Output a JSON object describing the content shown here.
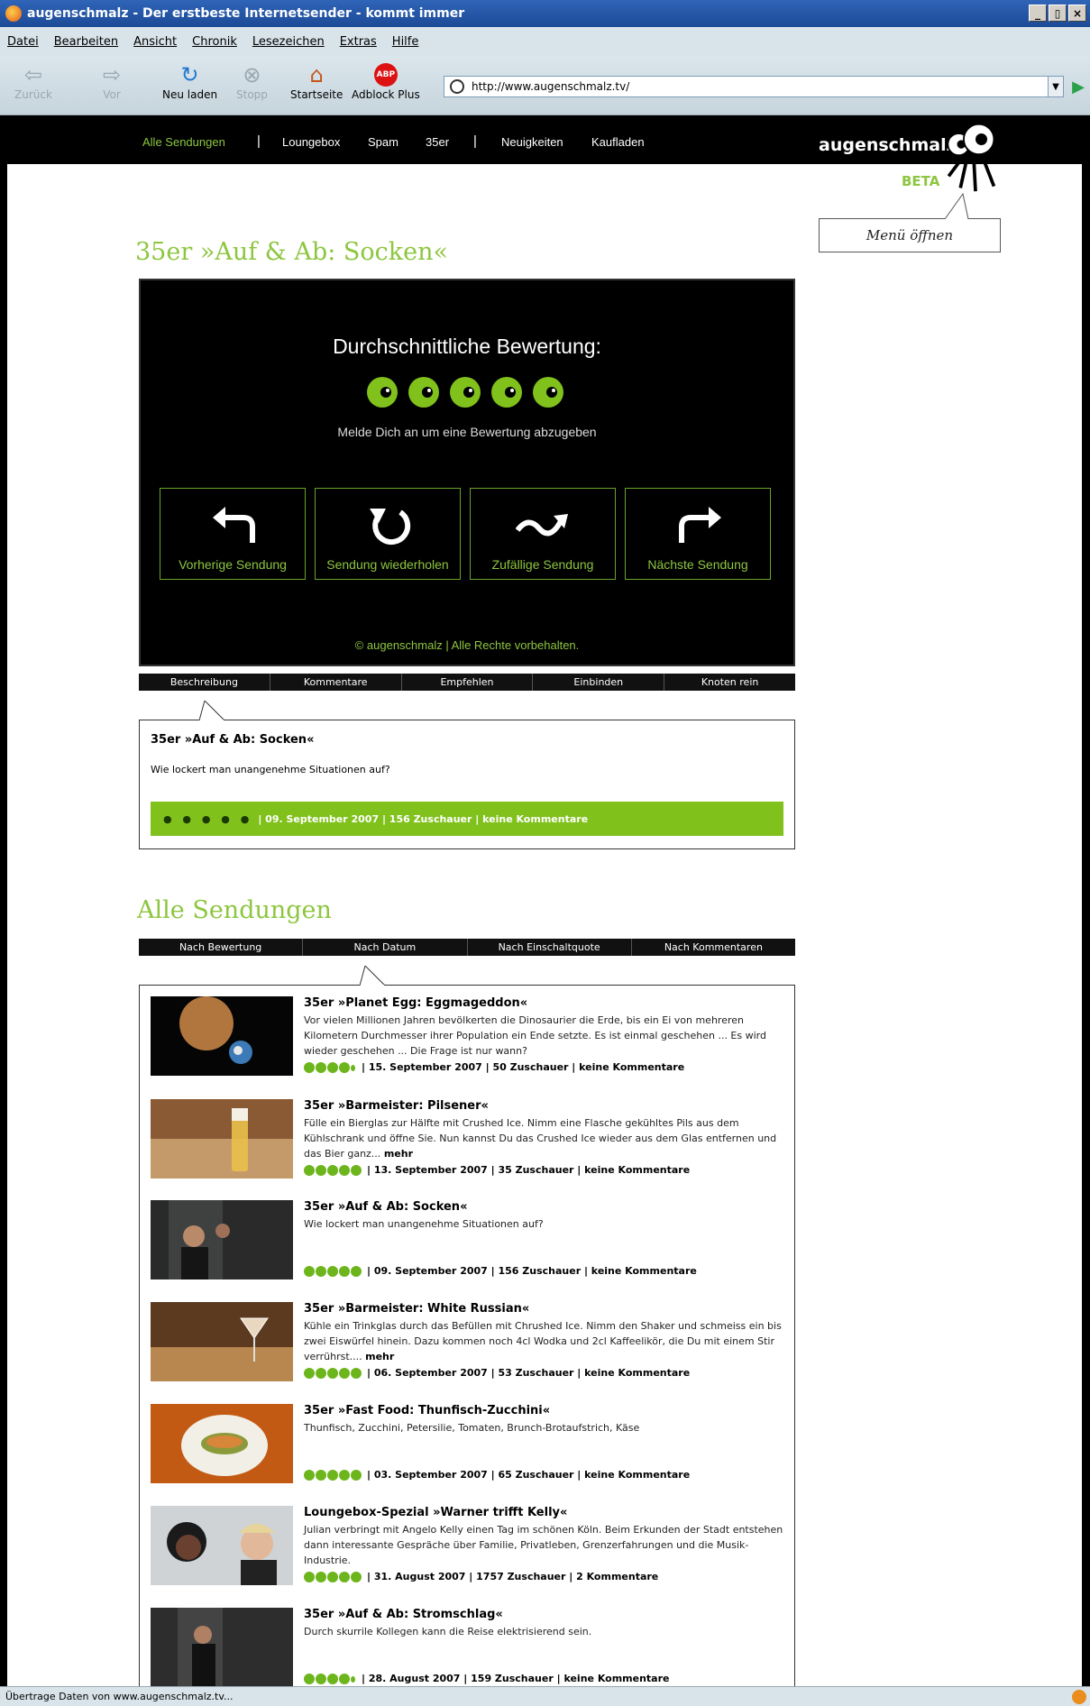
{
  "window": {
    "title": "augenschmalz - Der erstbeste Internetsender - kommt immer",
    "buttons": [
      "_",
      "▯",
      "×"
    ]
  },
  "menubar": [
    "Datei",
    "Bearbeiten",
    "Ansicht",
    "Chronik",
    "Lesezeichen",
    "Extras",
    "Hilfe"
  ],
  "toolbar": {
    "back": "Zurück",
    "forward": "Vor",
    "reload": "Neu laden",
    "stop": "Stopp",
    "home": "Startseite",
    "adblock": "Adblock Plus",
    "adblock_badge": "ABP",
    "url": "http://www.augenschmalz.tv/"
  },
  "sitenav": {
    "items": [
      "Alle Sendungen",
      "Loungebox",
      "Spam",
      "35er",
      "Neuigkeiten",
      "Kaufladen"
    ],
    "separator": "|"
  },
  "brand": {
    "logo": "augenschmalz",
    "beta": "BETA",
    "menu_button": "Menü öffnen"
  },
  "current": {
    "heading": "35er »Auf & Ab: Socken«",
    "avg_label": "Durchschnittliche Bewertung:",
    "login_hint": "Melde Dich an um eine Bewertung abzugeben",
    "nav": [
      "Vorherige Sendung",
      "Sendung wiederholen",
      "Zufällige Sendung",
      "Nächste Sendung"
    ],
    "copyright": "© augenschmalz | Alle Rechte vorbehalten.",
    "tabs": [
      "Beschreibung",
      "Kommentare",
      "Empfehlen",
      "Einbinden",
      "Knoten rein"
    ],
    "desc_title": "35er »Auf & Ab: Socken«",
    "desc_text": "Wie lockert man unangenehme Situationen auf?",
    "rating_dots": "● ● ● ● ●",
    "meta": "| 09. September 2007 | 156 Zuschauer | keine Kommentare"
  },
  "all": {
    "heading": "Alle Sendungen",
    "sort_tabs": [
      "Nach Bewertung",
      "Nach Datum",
      "Nach Einschaltquote",
      "Nach Kommentaren"
    ],
    "episodes": [
      {
        "title": "35er »Planet Egg: Eggmageddon«",
        "desc": "Vor vielen Millionen Jahren bevölkerten die Dinosaurier die Erde, bis ein Ei von mehreren Kilometern Durchmesser ihrer Population ein Ende setzte. Es ist einmal geschehen ... Es wird wieder geschehen ... Die Frage ist nur wann?",
        "more": "",
        "rating": 4.5,
        "meta": "| 15. September 2007 | 50 Zuschauer | keine Kommentare"
      },
      {
        "title": "35er »Barmeister: Pilsener«",
        "desc": "Fülle ein Bierglas zur Hälfte mit Crushed Ice. Nimm eine Flasche gekühltes Pils aus dem Kühlschrank und öffne Sie. Nun kannst Du das Crushed Ice wieder aus dem Glas entfernen und das Bier ganz...",
        "more": "mehr",
        "rating": 5,
        "meta": "| 13. September 2007 | 35 Zuschauer | keine Kommentare"
      },
      {
        "title": "35er »Auf & Ab: Socken«",
        "desc": "Wie lockert man unangenehme Situationen auf?",
        "more": "",
        "rating": 5,
        "meta": "| 09. September 2007 | 156 Zuschauer | keine Kommentare"
      },
      {
        "title": "35er »Barmeister: White Russian«",
        "desc": "Kühle ein Trinkglas durch das Befüllen mit Chrushed Ice. Nimm den Shaker und schmeiss ein bis zwei Eiswürfel hinein. Dazu kommen noch 4cl Wodka und 2cl Kaffeelikör, die Du mit einem Stir verrührst....",
        "more": "mehr",
        "rating": 5,
        "meta": "| 06. September 2007 | 53 Zuschauer | keine Kommentare"
      },
      {
        "title": "35er »Fast Food: Thunfisch-Zucchini«",
        "desc": "Thunfisch, Zucchini, Petersilie, Tomaten, Brunch-Brotaufstrich, Käse",
        "more": "",
        "rating": 5,
        "meta": "| 03. September 2007 | 65 Zuschauer | keine Kommentare"
      },
      {
        "title": "Loungebox-Spezial »Warner trifft Kelly«",
        "desc": "Julian verbringt mit Angelo Kelly einen Tag im schönen Köln. Beim Erkunden der Stadt entstehen dann interessante Gespräche über Familie, Privatleben, Grenzerfahrungen und die Musik-Industrie.",
        "more": "",
        "rating": 5,
        "meta": "| 31. August 2007 | 1757 Zuschauer | 2 Kommentare"
      },
      {
        "title": "35er »Auf & Ab: Stromschlag«",
        "desc": "Durch skurrile Kollegen kann die Reise elektrisierend sein.",
        "more": "",
        "rating": 4.5,
        "meta": "| 28. August 2007 | 159 Zuschauer | keine Kommentare"
      }
    ]
  },
  "status": "Übertrage Daten von www.augenschmalz.tv...",
  "colors": {
    "accent": "#8dc63f",
    "bar": "#80c11c"
  }
}
